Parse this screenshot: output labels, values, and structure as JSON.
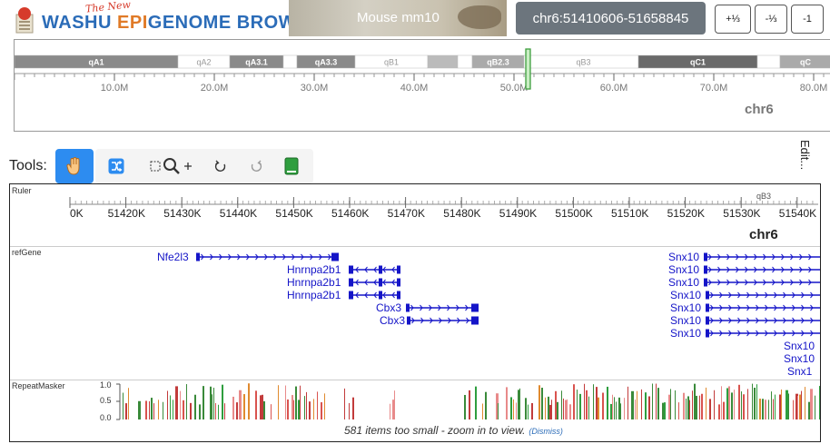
{
  "header": {
    "logo_new": "The New",
    "logo_washu": "WASHU",
    "logo_epi": "EPI",
    "logo_genome": "GENOME",
    "logo_browser": "BROWSER",
    "genome_label": "Mouse mm10",
    "coordinates": "chr6:51410606-51658845",
    "zoom_buttons": [
      "+⅓",
      "-⅓",
      "-1"
    ]
  },
  "ideogram": {
    "chromosome": "chr6",
    "bands": [
      {
        "label": "qA1",
        "start": 0,
        "end": 180,
        "shade": "#8a8a8a"
      },
      {
        "label": "qA2",
        "start": 180,
        "end": 237,
        "shade": "#ffffff"
      },
      {
        "label": "qA3.1",
        "start": 237,
        "end": 296,
        "shade": "#8a8a8a"
      },
      {
        "label": "",
        "start": 296,
        "end": 311,
        "shade": "#ffffff"
      },
      {
        "label": "qA3.3",
        "start": 311,
        "end": 375,
        "shade": "#8a8a8a"
      },
      {
        "label": "qB1",
        "start": 375,
        "end": 455,
        "shade": "#ffffff"
      },
      {
        "label": "",
        "start": 455,
        "end": 488,
        "shade": "#bbbbbb"
      },
      {
        "label": "",
        "start": 488,
        "end": 504,
        "shade": "#ffffff"
      },
      {
        "label": "qB2.3",
        "start": 504,
        "end": 561,
        "shade": "#aaaaaa"
      },
      {
        "label": "",
        "start": 561,
        "end": 566,
        "shade": "#ffffff"
      },
      {
        "label": "qB3",
        "start": 566,
        "end": 687,
        "shade": "#ffffff"
      },
      {
        "label": "qC1",
        "start": 687,
        "end": 818,
        "shade": "#6a6a6a"
      },
      {
        "label": "",
        "start": 818,
        "end": 843,
        "shade": "#ffffff"
      },
      {
        "label": "qC",
        "start": 843,
        "end": 899,
        "shade": "#aaaaaa"
      }
    ],
    "scale_labels": [
      "10.0M",
      "20.0M",
      "30.0M",
      "40.0M",
      "50.0M",
      "60.0M",
      "70.0M",
      "80.0M"
    ]
  },
  "tools": {
    "label": "Tools:",
    "edit_label": "Edit..."
  },
  "tracks": {
    "ruler": {
      "name": "Ruler",
      "band": "qB3",
      "ticks": [
        "0K",
        "51420K",
        "51430K",
        "51440K",
        "51450K",
        "51460K",
        "51470K",
        "51480K",
        "51490K",
        "51500K",
        "51510K",
        "51520K",
        "51530K",
        "51540K"
      ],
      "chromosome": "chr6"
    },
    "refgene": {
      "name": "refGene",
      "genes": [
        {
          "label": "Nfe2l3",
          "row": 0,
          "strand": "+"
        },
        {
          "label": "Hnrnpa2b1",
          "row": 1,
          "strand": "-"
        },
        {
          "label": "Hnrnpa2b1",
          "row": 2,
          "strand": "-"
        },
        {
          "label": "Hnrnpa2b1",
          "row": 3,
          "strand": "-"
        },
        {
          "label": "Cbx3",
          "row": 4,
          "strand": "+"
        },
        {
          "label": "Cbx3",
          "row": 5,
          "strand": "+"
        },
        {
          "label": "Snx10",
          "row": 0,
          "strand": "+"
        },
        {
          "label": "Snx10",
          "row": 1,
          "strand": "+"
        },
        {
          "label": "Snx10",
          "row": 2,
          "strand": "+"
        },
        {
          "label": "Snx10",
          "row": 3,
          "strand": "+"
        },
        {
          "label": "Snx10",
          "row": 4,
          "strand": "+"
        },
        {
          "label": "Snx10",
          "row": 5,
          "strand": "+"
        },
        {
          "label": "Snx10",
          "row": 6,
          "strand": "+"
        },
        {
          "label": "Snx10",
          "row": 7,
          "strand": "+"
        },
        {
          "label": "Snx10",
          "row": 8,
          "strand": "+"
        },
        {
          "label": "Snx1",
          "row": 9,
          "strand": "+"
        }
      ]
    },
    "repeatmasker": {
      "name": "RepeatMasker",
      "axis": [
        "1.0",
        "0.5",
        "0.0"
      ],
      "notice": "581 items too small - zoom in to view.",
      "dismiss": "(Dismiss)"
    }
  },
  "colors": {
    "accent": "#2d8cf0",
    "gene": "#1515c8",
    "coord_bg": "#6c757d"
  }
}
